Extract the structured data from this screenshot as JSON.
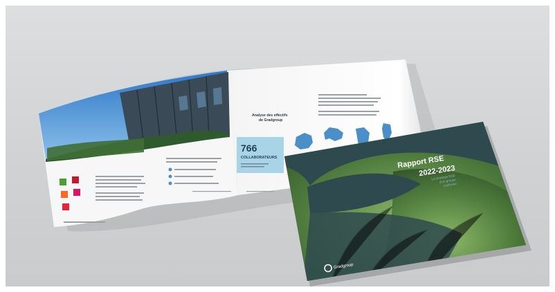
{
  "cover": {
    "title_line1": "Rapport RSE",
    "title_line2": "2022-2023",
    "subtitle_line1": "La stratégie RSE",
    "subtitle_line2": "d'un groupe",
    "subtitle_line3": "conforme",
    "brand": "Gradgroup"
  },
  "inside": {
    "headcount_number": "766",
    "headcount_label": "COLLABORATEURS",
    "staff_heading_line1": "Analyse des effectifs",
    "staff_heading_line2": "de Gradgroup"
  },
  "colors": {
    "cover_bg": "#2f4a4e",
    "info_box": "#a9d4e8",
    "map_blue": "#4a8fc7"
  }
}
